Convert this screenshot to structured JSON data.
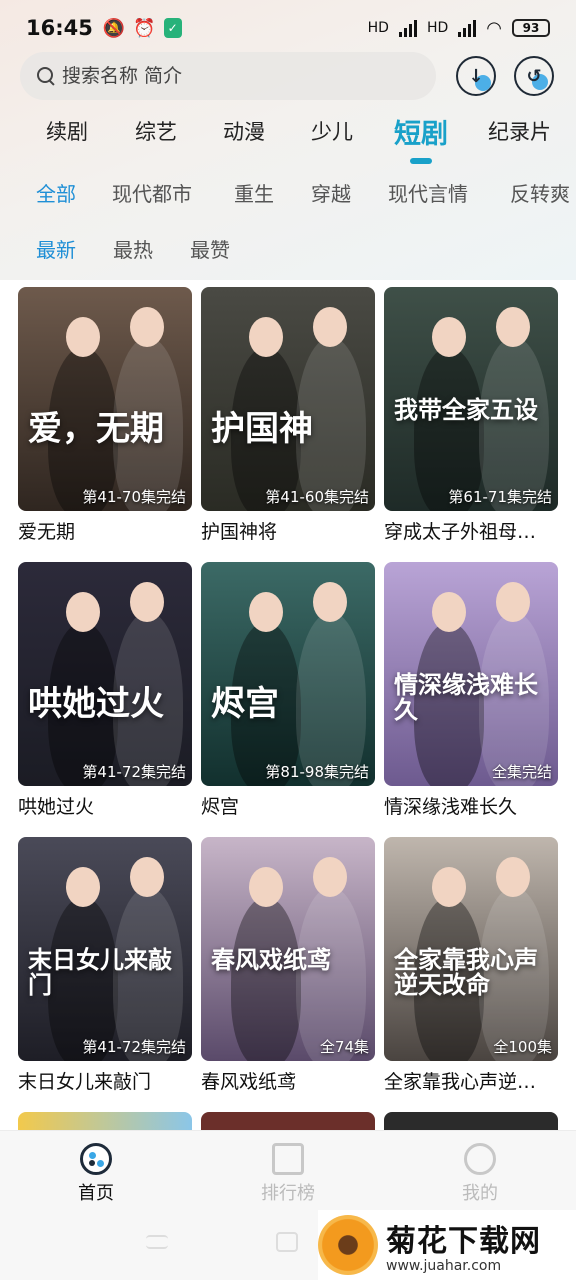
{
  "status_bar": {
    "time": "16:45",
    "battery": "93",
    "network_label_1": "HD",
    "network_label_2": "HD"
  },
  "search": {
    "placeholder": "搜索名称 简介"
  },
  "category_tabs": [
    "续剧",
    "综艺",
    "动漫",
    "少儿",
    "短剧",
    "纪录片"
  ],
  "active_category": "短剧",
  "genre_tabs": [
    "全部",
    "现代都市",
    "重生",
    "穿越",
    "现代言情",
    "反转爽"
  ],
  "sort_tabs": [
    "最新",
    "最热",
    "最赞"
  ],
  "cards": [
    {
      "title": "爱无期",
      "badge": "第41-70集完结",
      "art": "爱，无期",
      "bg_top": "#6e5a4c",
      "bg_bottom": "#2f2620"
    },
    {
      "title": "护国神将",
      "badge": "第41-60集完结",
      "art": "护国神",
      "bg_top": "#4a4a44",
      "bg_bottom": "#2a2b24"
    },
    {
      "title": "穿成太子外祖母…",
      "badge": "第61-71集完结",
      "art": "我带全家五设",
      "bg_top": "#3f5048",
      "bg_bottom": "#1e2a27"
    },
    {
      "title": "哄她过火",
      "badge": "第41-72集完结",
      "art": "哄她过火",
      "bg_top": "#2c2a3a",
      "bg_bottom": "#1b1c24"
    },
    {
      "title": "烬宫",
      "badge": "第81-98集完结",
      "art": "烬宫",
      "bg_top": "#3c6a66",
      "bg_bottom": "#12302e"
    },
    {
      "title": "情深缘浅难长久",
      "badge": "全集完结",
      "art": "情深缘浅难长久",
      "bg_top": "#b9a4d6",
      "bg_bottom": "#6d5a8f"
    },
    {
      "title": "末日女儿来敲门",
      "badge": "第41-72集完结",
      "art": "末日女儿来敲门",
      "bg_top": "#4a4a58",
      "bg_bottom": "#1e1e26"
    },
    {
      "title": "春风戏纸鸢",
      "badge": "全74集",
      "art": "春风戏纸鸢",
      "bg_top": "#c7b5c8",
      "bg_bottom": "#5a4a6a"
    },
    {
      "title": "全家靠我心声逆…",
      "badge": "全100集",
      "art": "全家靠我心声逆天改命",
      "bg_top": "#bfb6ad",
      "bg_bottom": "#4a4440"
    }
  ],
  "bottom_nav": [
    "首页",
    "排行榜",
    "我的"
  ],
  "watermark": {
    "title": "菊花下载网",
    "url": "www.juahar.com"
  },
  "colors": {
    "accent": "#19a1c9",
    "chip_active": "#1f8fd6"
  }
}
